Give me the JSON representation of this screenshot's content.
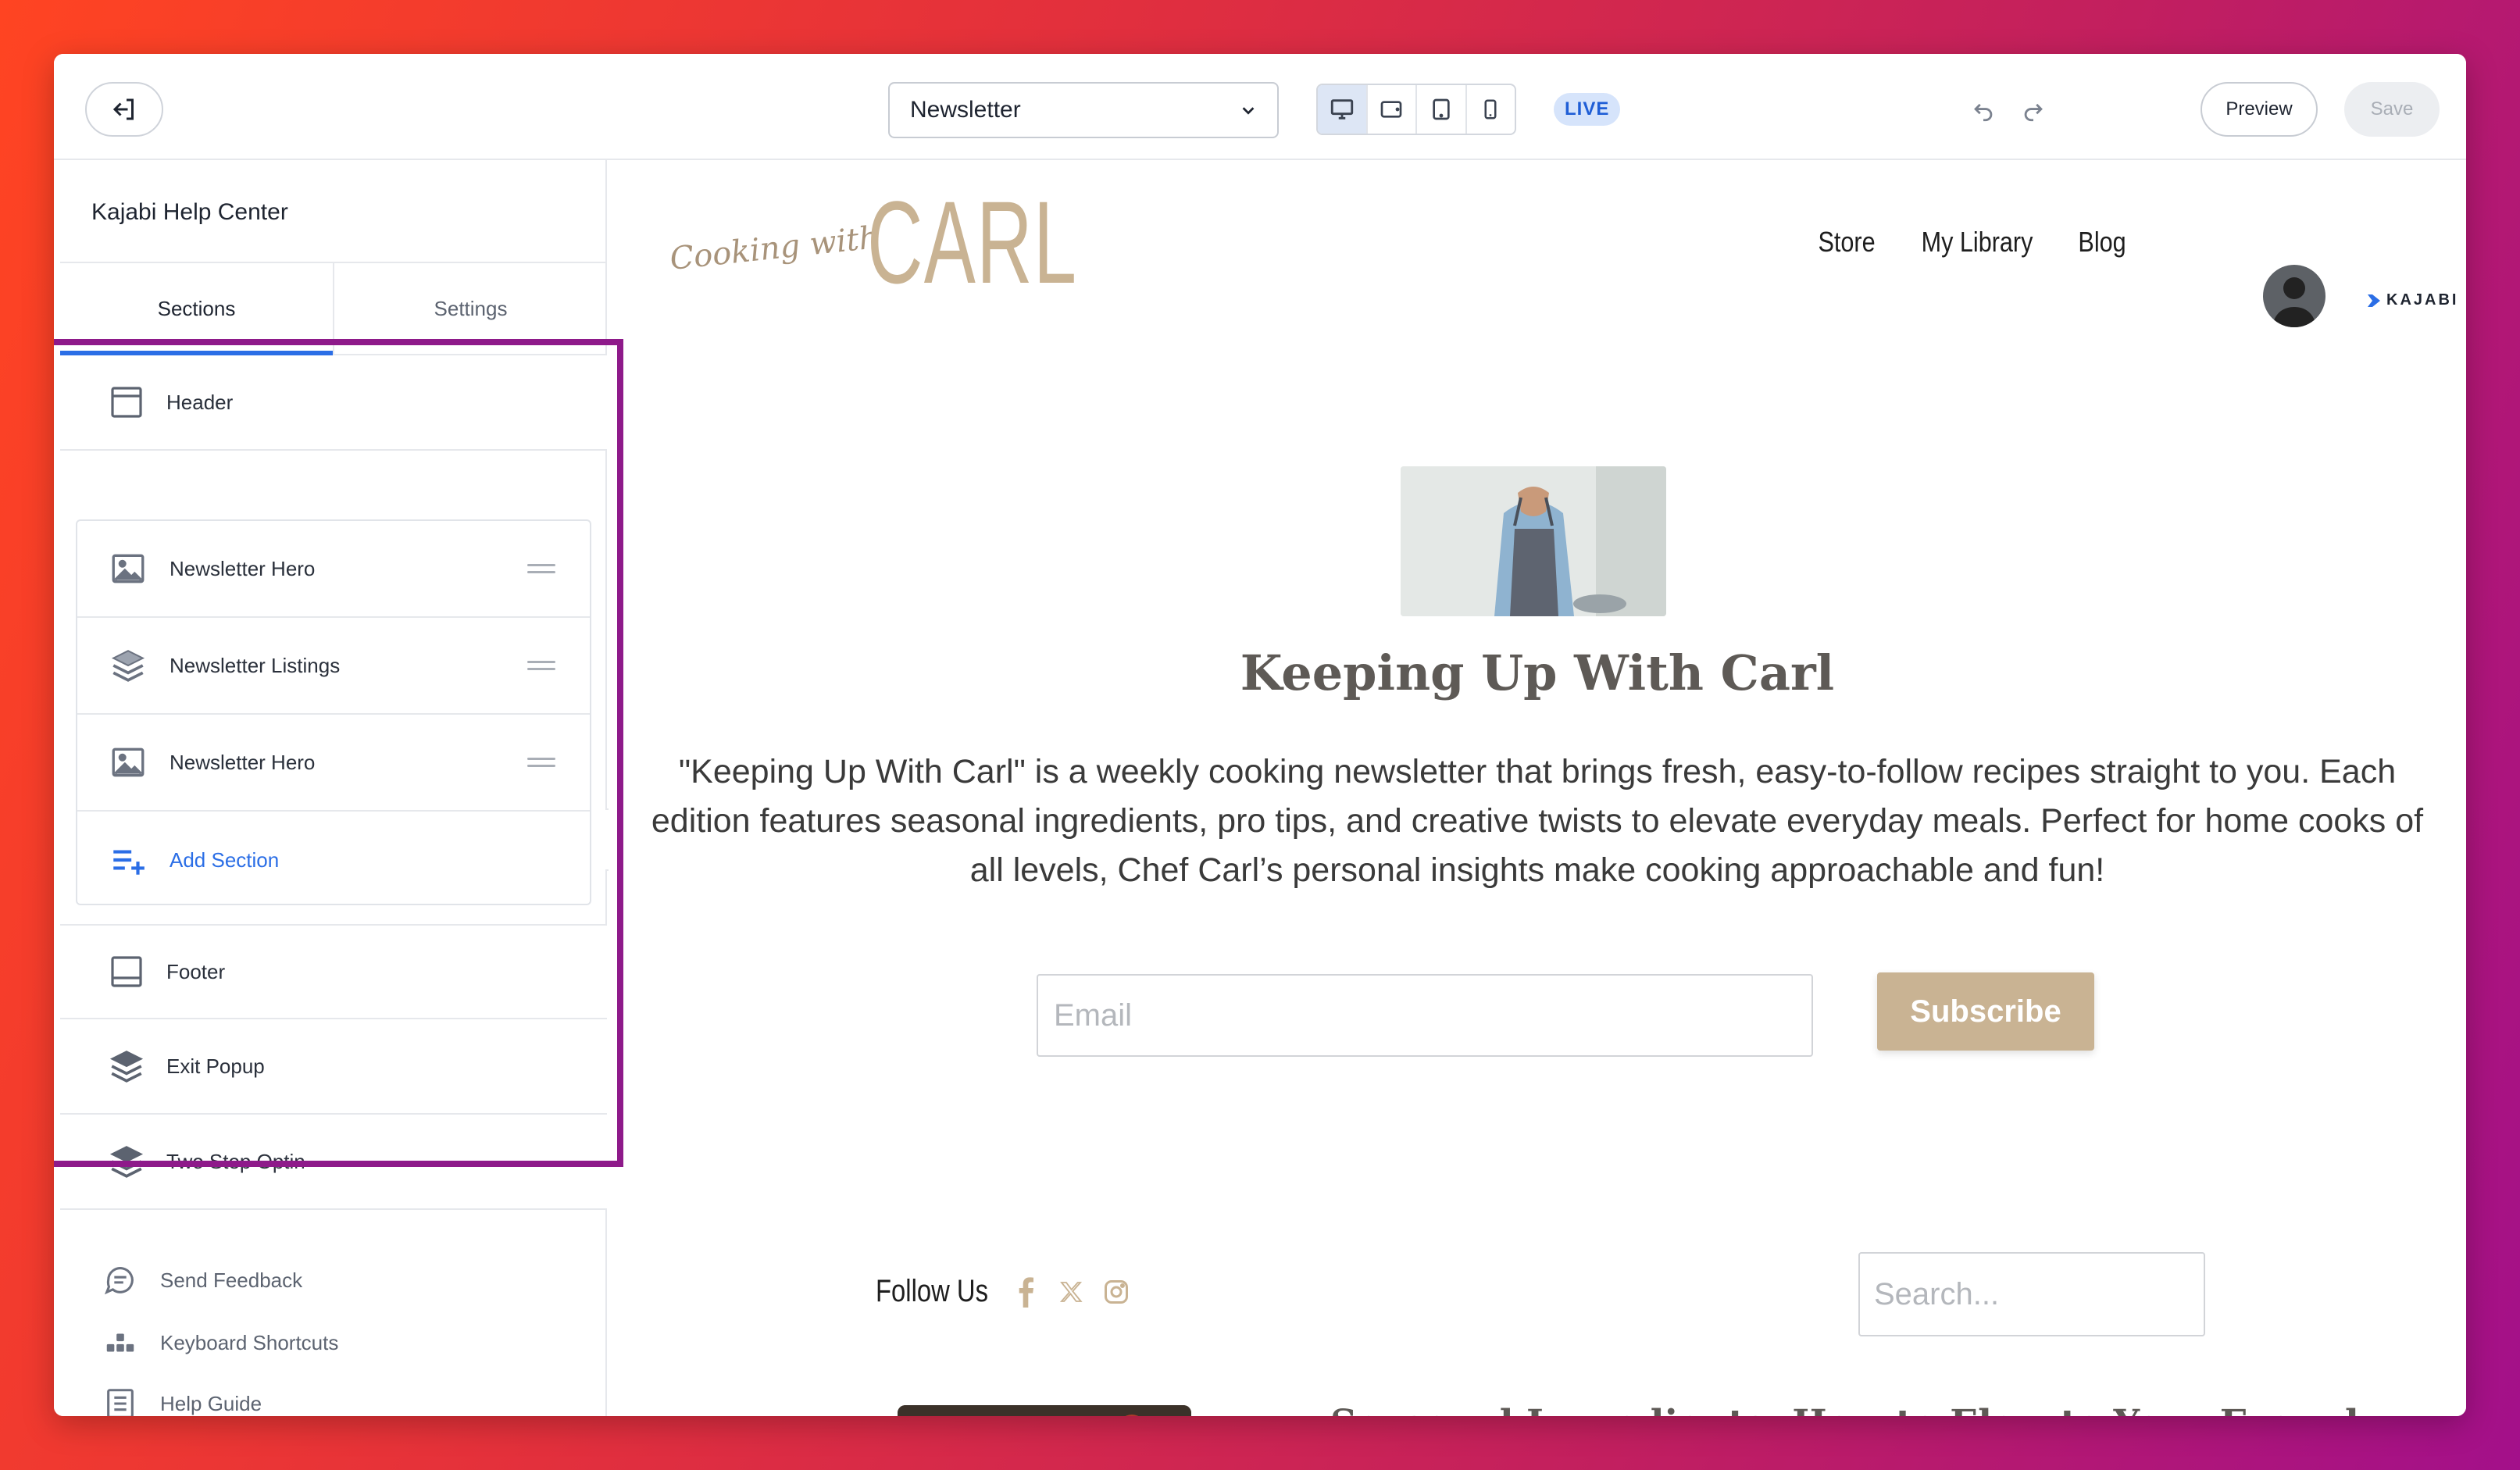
{
  "topbar": {
    "page_select_value": "Newsletter",
    "live_label": "LIVE",
    "preview_label": "Preview",
    "save_label": "Save"
  },
  "sidebar": {
    "site_name": "Kajabi Help Center",
    "tabs": [
      {
        "label": "Sections",
        "active": true
      },
      {
        "label": "Settings",
        "active": false
      }
    ],
    "header_label": "Header",
    "group_items": [
      {
        "label": "Newsletter Hero",
        "icon": "image-icon"
      },
      {
        "label": "Newsletter Listings",
        "icon": "layers-icon"
      },
      {
        "label": "Newsletter Hero",
        "icon": "image-icon"
      }
    ],
    "add_section_label": "Add Section",
    "footer_items": [
      {
        "label": "Footer",
        "icon": "footer-layout-icon"
      },
      {
        "label": "Exit Popup",
        "icon": "layers-icon"
      },
      {
        "label": "Two Step Optin",
        "icon": "layers-icon"
      }
    ],
    "utilities": [
      {
        "label": "Send Feedback",
        "icon": "chat-bubble-icon"
      },
      {
        "label": "Keyboard Shortcuts",
        "icon": "keyboard-icon"
      },
      {
        "label": "Help Guide",
        "icon": "document-icon"
      }
    ]
  },
  "canvas": {
    "logo_script": "Cooking with",
    "logo_big": "CARL",
    "nav": [
      "Store",
      "My Library",
      "Blog"
    ],
    "kajabi_label": "KAJABI",
    "hero_title": "Keeping Up With Carl",
    "hero_desc": "\"Keeping Up With Carl\" is a weekly cooking newsletter that brings fresh, easy-to-follow recipes straight to you. Each edition features seasonal ingredients, pro tips, and creative twists to elevate everyday meals. Perfect for home cooks of all levels, Chef Carl’s personal insights make cooking approachable and fun!",
    "email_placeholder": "Email",
    "subscribe_label": "Subscribe",
    "follow_label": "Follow Us",
    "search_placeholder": "Search...",
    "post_title": "Seasonal Ingredients: How to Elevate Your Everyday"
  },
  "colors": {
    "accent_blue": "#2b6ee6",
    "brand_tan": "#c9b393",
    "highlight_purple": "#8e1a8a"
  }
}
